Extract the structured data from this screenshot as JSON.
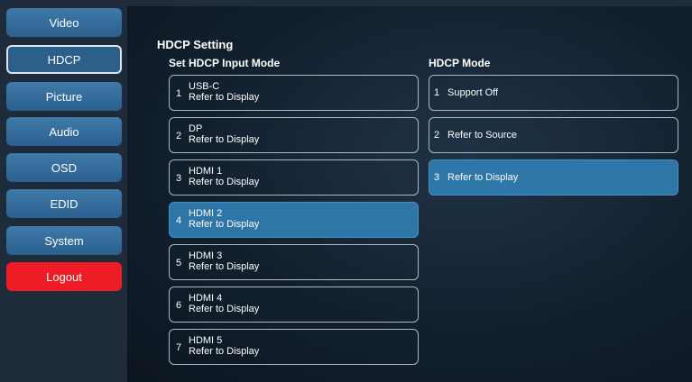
{
  "sidebar": {
    "items": [
      {
        "label": "Video"
      },
      {
        "label": "HDCP"
      },
      {
        "label": "Picture"
      },
      {
        "label": "Audio"
      },
      {
        "label": "OSD"
      },
      {
        "label": "EDID"
      },
      {
        "label": "System"
      },
      {
        "label": "Logout"
      }
    ],
    "active": "HDCP"
  },
  "main": {
    "section_title": "HDCP Setting",
    "input_mode_title": "Set HDCP Input Mode",
    "hdcp_mode_title": "HDCP Mode",
    "inputs": [
      {
        "num": "1",
        "name": "USB-C",
        "mode": "Refer to Display"
      },
      {
        "num": "2",
        "name": "DP",
        "mode": "Refer to Display"
      },
      {
        "num": "3",
        "name": "HDMI 1",
        "mode": "Refer to Display"
      },
      {
        "num": "4",
        "name": "HDMI 2",
        "mode": "Refer to Display"
      },
      {
        "num": "5",
        "name": "HDMI 3",
        "mode": "Refer to Display"
      },
      {
        "num": "6",
        "name": "HDMI 4",
        "mode": "Refer to Display"
      },
      {
        "num": "7",
        "name": "HDMI 5",
        "mode": "Refer to Display"
      }
    ],
    "selected_input": "HDMI 2",
    "modes": [
      {
        "num": "1",
        "label": "Support Off"
      },
      {
        "num": "2",
        "label": "Refer to Source"
      },
      {
        "num": "3",
        "label": "Refer to Display"
      }
    ],
    "selected_mode": "Refer to Display"
  },
  "colors": {
    "accent": "#2f76a8",
    "logout": "#ee1c24",
    "nav_button": "#3a74a2"
  }
}
